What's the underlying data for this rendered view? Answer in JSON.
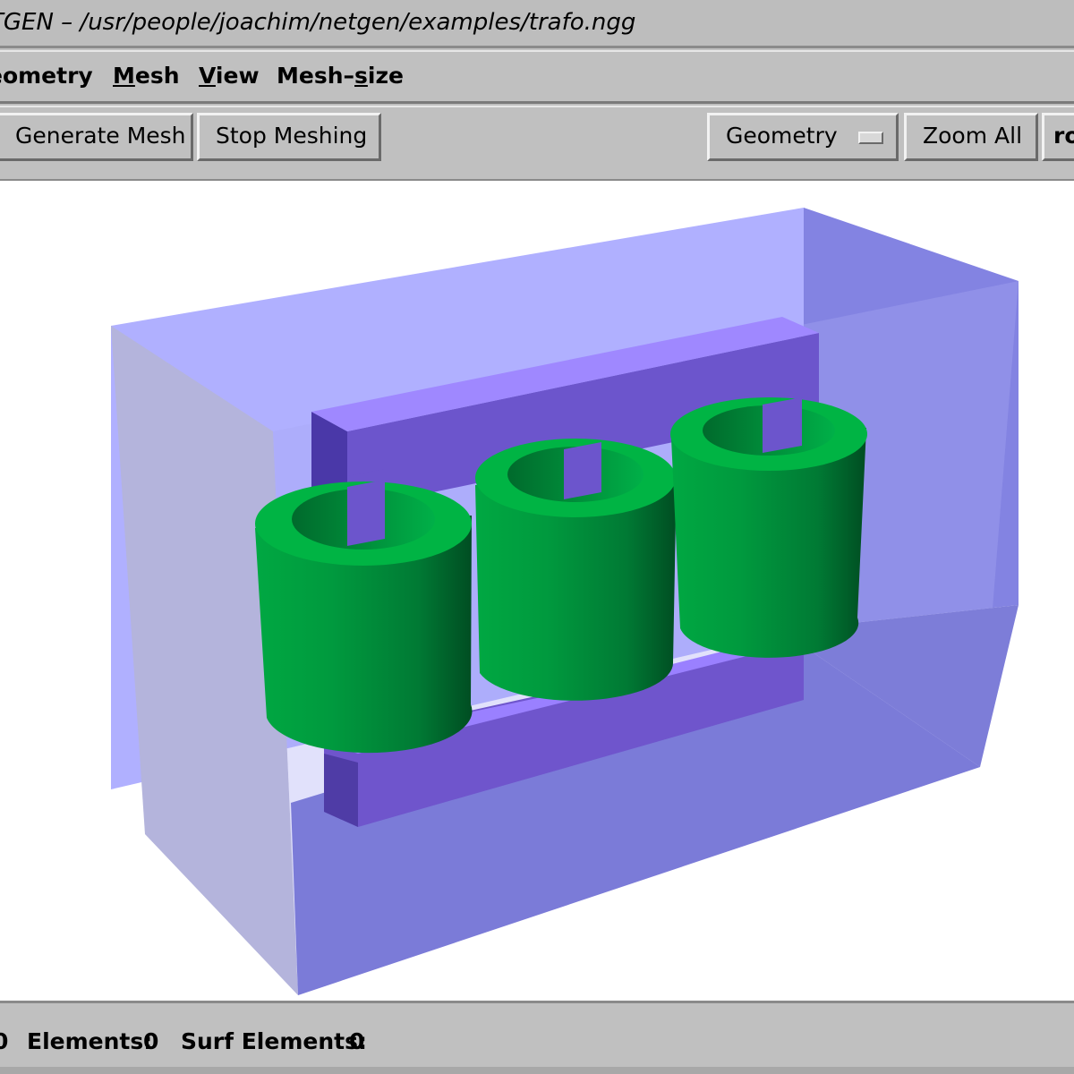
{
  "window": {
    "title": "TGEN – /usr/people/joachim/netgen/examples/trafo.ngg"
  },
  "menubar": {
    "items": [
      {
        "pre": "",
        "u": "",
        "post": "eometry"
      },
      {
        "pre": "",
        "u": "M",
        "post": "esh"
      },
      {
        "pre": "",
        "u": "V",
        "post": "iew"
      },
      {
        "pre": "Mesh–",
        "u": "s",
        "post": "ize"
      }
    ]
  },
  "toolbar": {
    "generate_label": "Generate Mesh",
    "stop_label": "Stop Meshing",
    "select_value": "Geometry",
    "zoom_label": "Zoom All",
    "rotate_label": "ro"
  },
  "status": {
    "left_fragment": "0",
    "elements_label": "Elements:",
    "elements_value": "0",
    "surf_label": "Surf Elements:",
    "surf_value": "0"
  },
  "colors": {
    "viewport_bg": "#ffffff",
    "box_face": "#aaaaf5",
    "box_dark": "#7c7cd8",
    "core": "#6e56cc",
    "coil": "#008a3c"
  },
  "icons": {
    "select_indicator": "option-menu-indicator"
  }
}
